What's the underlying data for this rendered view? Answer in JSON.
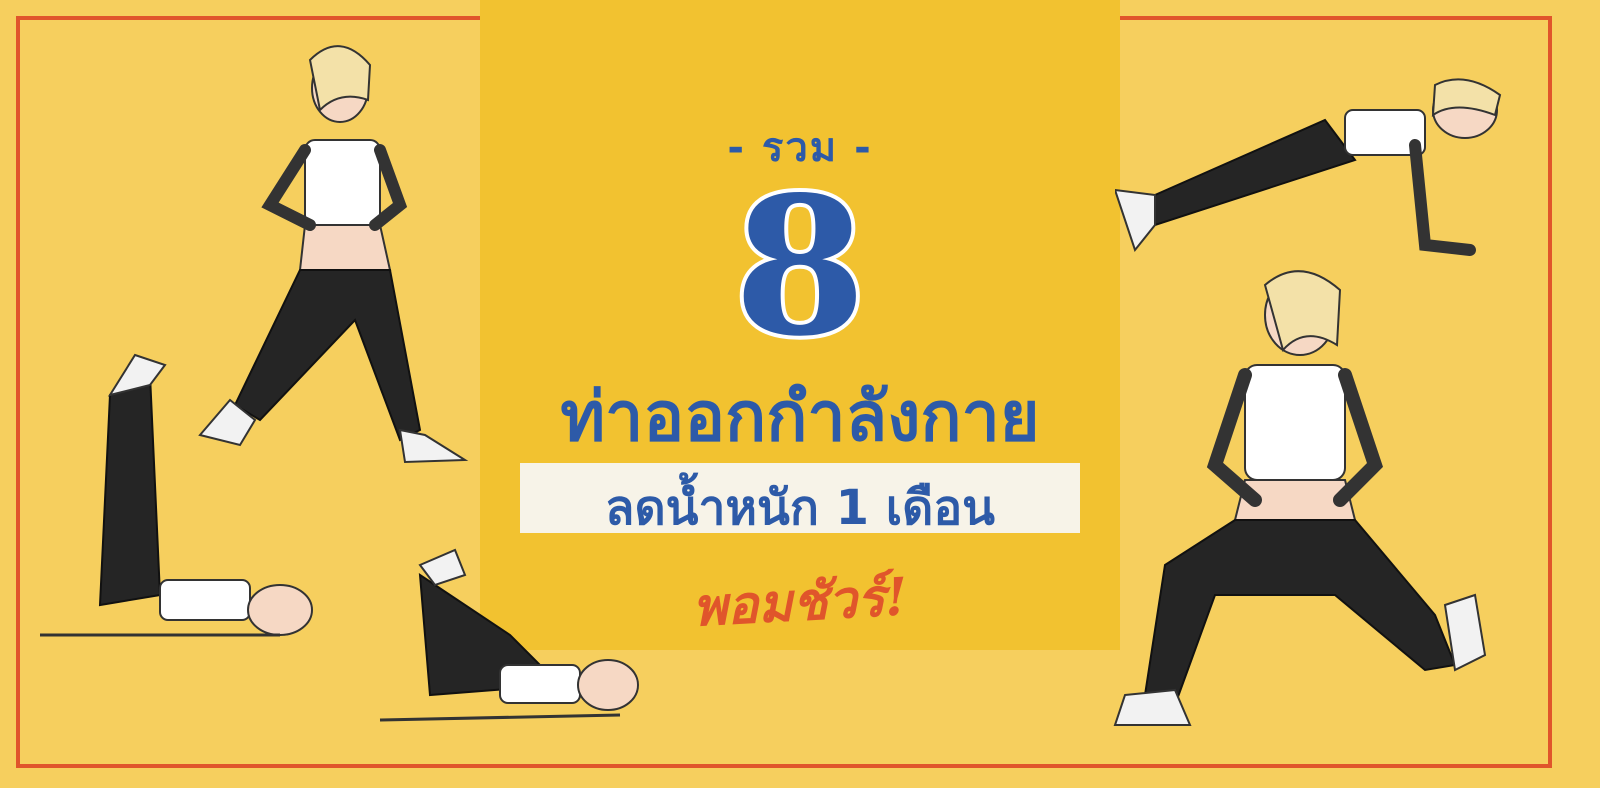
{
  "banner": {
    "kicker": "- รวม -",
    "number": "8",
    "headline": "ท่าออกกำลังกาย",
    "subheadline": "ลดน้ำหนัก 1 เดือน",
    "tagline": "พอมชัวร์!"
  },
  "colors": {
    "background": "#f6cf5e",
    "center_panel": "#f2c230",
    "frame": "#e0552b",
    "title_blue": "#2d5aa8",
    "tagline_red": "#e0552b"
  }
}
